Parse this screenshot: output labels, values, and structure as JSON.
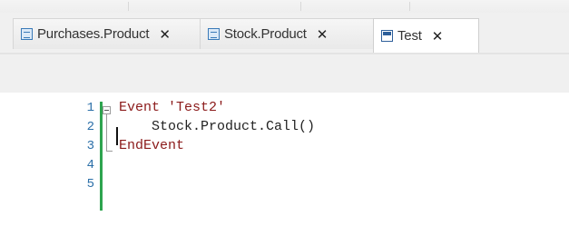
{
  "tabs": [
    {
      "label": "Purchases.Product",
      "close": "✕",
      "icon": "grid-object-icon",
      "active": false
    },
    {
      "label": "Stock.Product",
      "close": "✕",
      "icon": "grid-object-icon",
      "active": false
    },
    {
      "label": "Test",
      "close": "✕",
      "icon": "procedure-icon",
      "active": true
    }
  ],
  "editor": {
    "line_numbers": [
      "1",
      "2",
      "3",
      "4",
      "5"
    ],
    "lines": [
      {
        "kw": "Event",
        "rest": " 'Test2'"
      },
      {
        "text": "    Stock.Product.Call()"
      },
      {
        "kw": "EndEvent"
      },
      {
        "text": ""
      },
      {
        "text": ""
      }
    ]
  },
  "colors": {
    "change_marker": "#2ea44f",
    "keyword": "#8b1a1a",
    "line_number": "#2b6fa8"
  }
}
